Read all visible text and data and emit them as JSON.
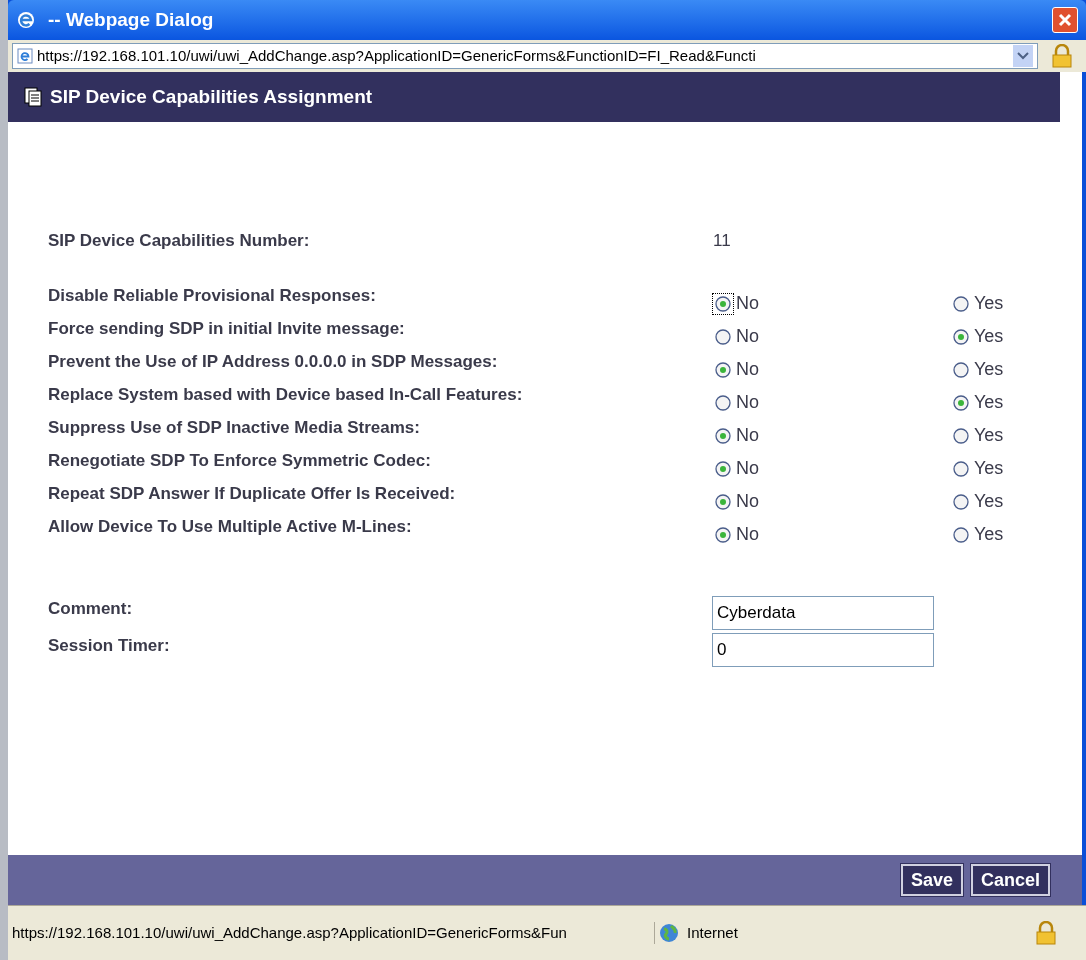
{
  "window": {
    "title": "-- Webpage Dialog"
  },
  "address_bar": {
    "url": "https://192.168.101.10/uwi/uwi_AddChange.asp?ApplicationID=GenericForms&FunctionID=FI_Read&Functi"
  },
  "header": {
    "title": "SIP Device Capabilities Assignment"
  },
  "number": {
    "label": "SIP Device Capabilities Number:",
    "value": "11"
  },
  "settings": [
    {
      "label": "Disable Reliable Provisional Responses:",
      "options": [
        {
          "label": "No",
          "selected": true,
          "focused": true
        },
        {
          "label": "Yes",
          "selected": false,
          "focused": false
        }
      ]
    },
    {
      "label": "Force sending SDP in initial Invite message:",
      "options": [
        {
          "label": "No",
          "selected": false,
          "focused": false
        },
        {
          "label": "Yes",
          "selected": true,
          "focused": false
        }
      ]
    },
    {
      "label": "Prevent the Use of IP Address 0.0.0.0 in SDP Messages:",
      "options": [
        {
          "label": "No",
          "selected": true,
          "focused": false
        },
        {
          "label": "Yes",
          "selected": false,
          "focused": false
        }
      ]
    },
    {
      "label": "Replace System based with Device based In-Call Features:",
      "options": [
        {
          "label": "No",
          "selected": false,
          "focused": false
        },
        {
          "label": "Yes",
          "selected": true,
          "focused": false
        }
      ]
    },
    {
      "label": "Suppress Use of SDP Inactive Media Streams:",
      "options": [
        {
          "label": "No",
          "selected": true,
          "focused": false
        },
        {
          "label": "Yes",
          "selected": false,
          "focused": false
        }
      ]
    },
    {
      "label": "Renegotiate SDP To Enforce Symmetric Codec:",
      "options": [
        {
          "label": "No",
          "selected": true,
          "focused": false
        },
        {
          "label": "Yes",
          "selected": false,
          "focused": false
        }
      ]
    },
    {
      "label": "Repeat SDP Answer If Duplicate Offer Is Received:",
      "options": [
        {
          "label": "No",
          "selected": true,
          "focused": false
        },
        {
          "label": "Yes",
          "selected": false,
          "focused": false
        }
      ]
    },
    {
      "label": "Allow Device To Use Multiple Active M-Lines:",
      "options": [
        {
          "label": "No",
          "selected": true,
          "focused": false
        },
        {
          "label": "Yes",
          "selected": false,
          "focused": false
        }
      ]
    }
  ],
  "fields": [
    {
      "label": "Comment:",
      "value": "Cyberdata"
    },
    {
      "label": "Session Timer:",
      "value": "0"
    }
  ],
  "buttons": [
    "Save",
    "Cancel"
  ],
  "status_bar": {
    "url": "https://192.168.101.10/uwi/uwi_AddChange.asp?ApplicationID=GenericForms&Fun",
    "zone": "Internet"
  }
}
